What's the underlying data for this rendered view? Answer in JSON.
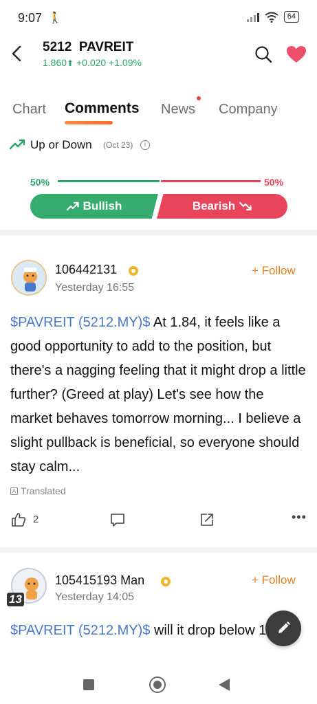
{
  "status": {
    "time": "9:07",
    "battery": "64"
  },
  "header": {
    "stock_code": "5212",
    "stock_name": "PAVREIT",
    "price": "1.860",
    "change": "+0.020",
    "change_pct": "+1.09%"
  },
  "tabs": [
    "Chart",
    "Comments",
    "News",
    "Company"
  ],
  "vote": {
    "title": "Up or Down",
    "date": "(Oct 23)",
    "bullish_pct": "50%",
    "bearish_pct": "50%",
    "bullish_fraction": 0.5,
    "bullish_label": "Bullish",
    "bearish_label": "Bearish"
  },
  "posts": [
    {
      "username": "106442131",
      "time": "Yesterday 16:55",
      "follow_label": "+ Follow",
      "ticker": "$PAVREIT (5212.MY)$",
      "text": " At 1.84, it feels like a good opportunity to add to the position, but there's a nagging feeling that it might drop a little further? (Greed at play) Let's see how the market behaves tomorrow morning... I believe a slight pullback is beneficial, so everyone should stay calm...",
      "translated_label": "Translated",
      "likes": "2"
    },
    {
      "username": "105415193 Man",
      "time": "Yesterday 14:05",
      "follow_label": "+ Follow",
      "ticker": "$PAVREIT (5212.MY)$",
      "text": " will it drop below 1.80?",
      "avatar_badge": "13"
    }
  ],
  "colors": {
    "up": "#2aa66a",
    "down": "#e8445a",
    "accent": "#e67e22",
    "link": "#4a78c8"
  }
}
